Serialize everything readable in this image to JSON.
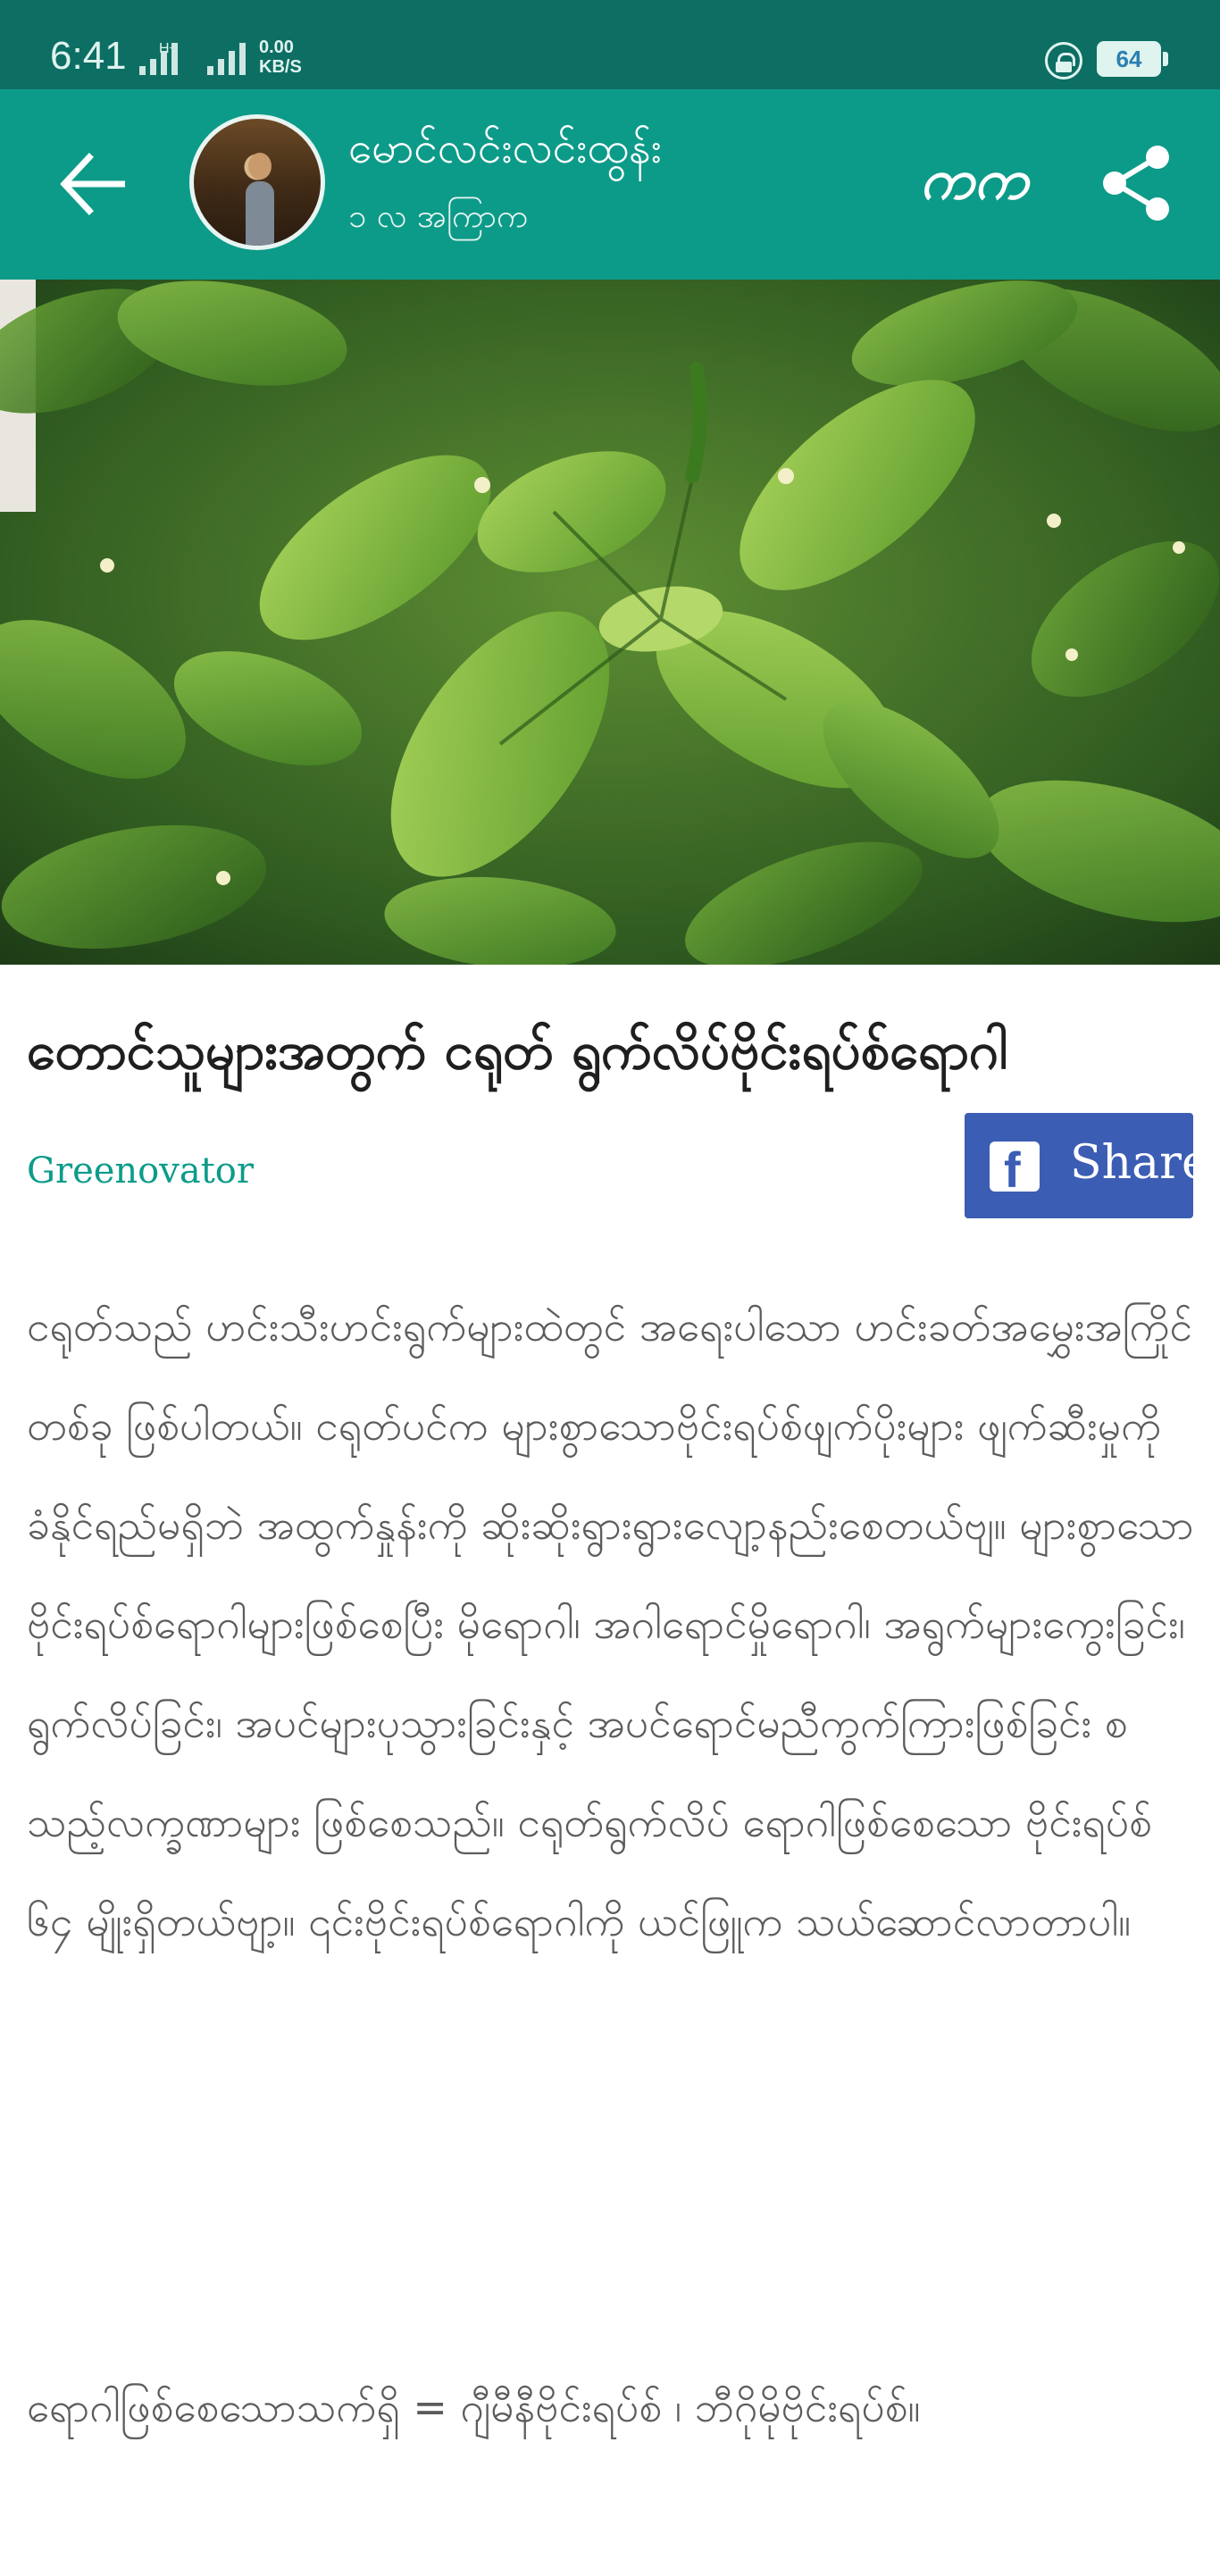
{
  "status_bar": {
    "time": "6:41",
    "network_type": "H+",
    "net_speed_value": "0.00",
    "net_speed_unit": "KB/S",
    "battery": "64"
  },
  "app_bar": {
    "author_name": "မောင်လင်းလင်းထွန်း",
    "post_time": "၁ လ အကြာက",
    "font_toggle": "ကက"
  },
  "article": {
    "title": "တောင်သူများအတွက် ငရုတ် ရွက်လိပ်ဗိုင်းရပ်စ်ရောဂါ",
    "source": "Greenovator",
    "share_label": "Share",
    "body": "ငရုတ်သည် ဟင်းသီးဟင်းရွက်များထဲတွင် အရေးပါသော ဟင်းခတ်အမွှေးအကြိုင်တစ်ခု ဖြစ်ပါတယ်။ ငရုတ်ပင်က များစွာသောဗိုင်းရပ်စ်ဖျက်ပိုးများ ဖျက်ဆီးမှုကို ခံနိုင်ရည်မရှိဘဲ အထွက်နှုန်းကို ဆိုးဆိုးရွားရွားလျော့နည်းစေတယ်ဗျ။ များစွာသော ဗိုင်းရပ်စ်ရောဂါများဖြစ်စေပြီး မိုရောဂါ၊ အဂါရောင်မှိုရောဂါ၊ အရွက်များကွေးခြင်း၊ ရွက်လိပ်ခြင်း၊ အပင်များပုသွားခြင်းနှင့် အပင်ရောင်မညီကွက်ကြားဖြစ်ခြင်း စသည့်လက္ခဏာများ ဖြစ်စေသည်။ ငရုတ်ရွက်လိပ် ရောဂါဖြစ်စေသော ဗိုင်းရပ်စ် ၆၄ မျိုးရှိတယ်ဗျာ့။ ၎င်းဗိုင်းရပ်စ်ရောဂါကို ယင်ဖြူက သယ်ဆောင်လာတာပါ။",
    "extra": "ရောဂါဖြစ်စေသောသက်ရှိ = ဂျီမီနီဗိုင်းရပ်စ် ၊ ဘီဂိုမိုဗိုင်းရပ်စ်။"
  },
  "icons": {
    "back": "arrow-left",
    "share": "share-nodes",
    "facebook": "facebook-logo",
    "lock": "rotation-lock"
  },
  "colors": {
    "status_bar": "#0d6e63",
    "app_bar": "#0d9b89",
    "facebook": "#3b5db4",
    "link": "#0d9b89"
  }
}
